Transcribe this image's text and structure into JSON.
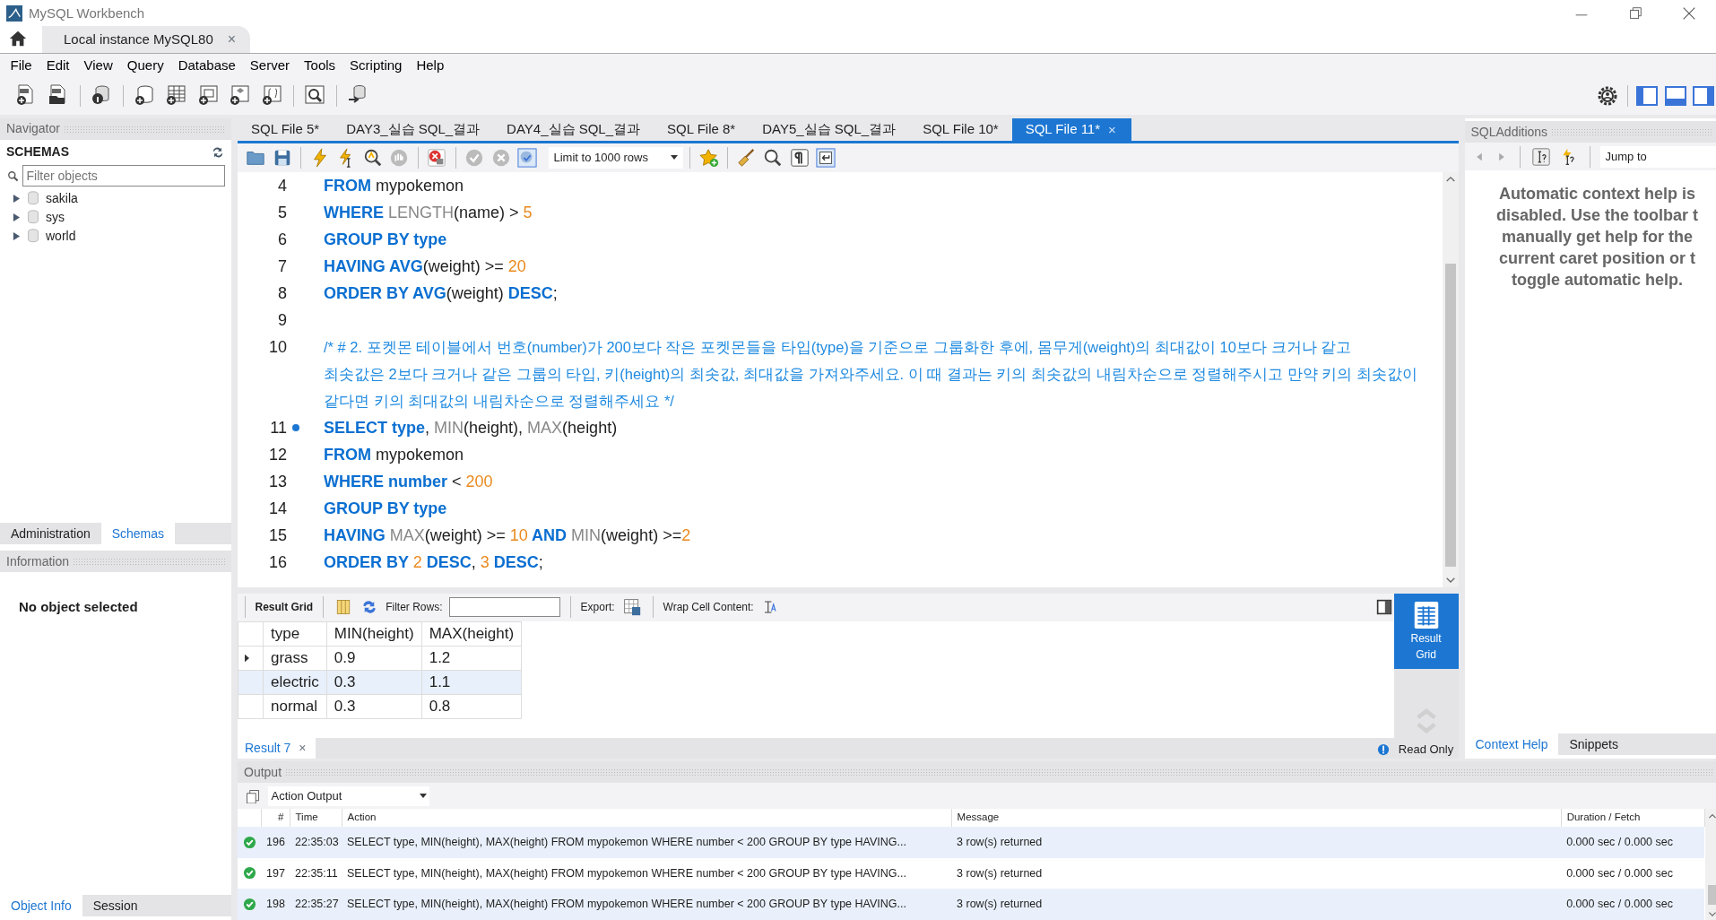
{
  "window": {
    "title": "MySQL Workbench"
  },
  "connection_tab": {
    "label": "Local instance MySQL80",
    "close": "×"
  },
  "menu": [
    "File",
    "Edit",
    "View",
    "Query",
    "Database",
    "Server",
    "Tools",
    "Scripting",
    "Help"
  ],
  "navigator": {
    "title": "Navigator",
    "section": "SCHEMAS",
    "filter": {
      "placeholder": "Filter objects"
    },
    "schemas": [
      {
        "name": "sakila",
        "expanded": false
      },
      {
        "name": "sys",
        "expanded": false
      },
      {
        "name": "world",
        "expanded": false
      }
    ],
    "tabs": [
      {
        "label": "Administration",
        "selected": false
      },
      {
        "label": "Schemas",
        "selected": true
      }
    ]
  },
  "information": {
    "title": "Information",
    "message": "No object selected",
    "tabs": [
      {
        "label": "Object Info",
        "selected": true
      },
      {
        "label": "Session",
        "selected": false
      }
    ]
  },
  "editor_tabs": [
    {
      "label": "SQL File 5*",
      "selected": false
    },
    {
      "label": "DAY3_실습 SQL_결과",
      "selected": false
    },
    {
      "label": "DAY4_실습 SQL_결과",
      "selected": false
    },
    {
      "label": "SQL File 8*",
      "selected": false
    },
    {
      "label": "DAY5_실습 SQL_결과",
      "selected": false
    },
    {
      "label": "SQL File 10*",
      "selected": false
    },
    {
      "label": "SQL File 11*",
      "selected": true,
      "close": "×"
    }
  ],
  "editor_toolbar": {
    "limit": "Limit to 1000 rows"
  },
  "code_lines": [
    {
      "number": "4",
      "marker": false,
      "tokens": [
        {
          "kind": "keyword",
          "text": "FROM"
        },
        {
          "kind": "plain",
          "text": " mypokemon"
        }
      ]
    },
    {
      "number": "5",
      "marker": false,
      "tokens": [
        {
          "kind": "keyword",
          "text": "WHERE "
        },
        {
          "kind": "function",
          "text": "LENGTH"
        },
        {
          "kind": "plain",
          "text": "(name) > "
        },
        {
          "kind": "number",
          "text": "5"
        }
      ]
    },
    {
      "number": "6",
      "marker": false,
      "tokens": [
        {
          "kind": "keyword",
          "text": "GROUP BY type"
        }
      ]
    },
    {
      "number": "7",
      "marker": false,
      "tokens": [
        {
          "kind": "keyword",
          "text": "HAVING AVG"
        },
        {
          "kind": "plain",
          "text": "(weight) >= "
        },
        {
          "kind": "number",
          "text": "20"
        }
      ]
    },
    {
      "number": "8",
      "marker": false,
      "tokens": [
        {
          "kind": "keyword",
          "text": "ORDER BY AVG"
        },
        {
          "kind": "plain",
          "text": "(weight) "
        },
        {
          "kind": "keyword",
          "text": "DESC"
        },
        {
          "kind": "plain",
          "text": ";"
        }
      ]
    },
    {
      "number": "9",
      "marker": false
    },
    {
      "number": "10",
      "marker": false,
      "tokens": [
        {
          "kind": "comment",
          "text": "/* # 2. 포켓몬 테이블에서 번호(number)가 200보다 작은 포켓몬들을 타입(type)을 기준으로 그룹화한 후에, 몸무게(weight)의 최대값이 10보다 크거나 같고"
        }
      ],
      "wrap": [
        "최솟값은 2보다 크거나 같은 그룹의 타입, 키(height)의 최솟값, 최대값을 가져와주세요. 이 때 결과는 키의 최솟값의 내림차순으로 정렬해주시고 만약 키의 최솟값이",
        "같다면 키의 최대값의 내림차순으로 정렬해주세요 */"
      ]
    },
    {
      "number": "11",
      "marker": true,
      "tokens": [
        {
          "kind": "keyword",
          "text": "SELECT type"
        },
        {
          "kind": "plain",
          "text": ", "
        },
        {
          "kind": "function",
          "text": "MIN"
        },
        {
          "kind": "plain",
          "text": "(height), "
        },
        {
          "kind": "function",
          "text": "MAX"
        },
        {
          "kind": "plain",
          "text": "(height)"
        }
      ]
    },
    {
      "number": "12",
      "marker": false,
      "tokens": [
        {
          "kind": "keyword",
          "text": "FROM"
        },
        {
          "kind": "plain",
          "text": " mypokemon"
        }
      ]
    },
    {
      "number": "13",
      "marker": false,
      "tokens": [
        {
          "kind": "keyword",
          "text": "WHERE number"
        },
        {
          "kind": "plain",
          "text": " < "
        },
        {
          "kind": "number",
          "text": "200"
        }
      ]
    },
    {
      "number": "14",
      "marker": false,
      "tokens": [
        {
          "kind": "keyword",
          "text": "GROUP BY type"
        }
      ]
    },
    {
      "number": "15",
      "marker": false,
      "tokens": [
        {
          "kind": "keyword",
          "text": "HAVING "
        },
        {
          "kind": "function",
          "text": "MAX"
        },
        {
          "kind": "plain",
          "text": "(weight) >= "
        },
        {
          "kind": "number",
          "text": "10"
        },
        {
          "kind": "keyword",
          "text": " AND "
        },
        {
          "kind": "function",
          "text": "MIN"
        },
        {
          "kind": "plain",
          "text": "(weight) >="
        },
        {
          "kind": "number",
          "text": "2"
        }
      ]
    },
    {
      "number": "16",
      "marker": false,
      "tokens": [
        {
          "kind": "keyword",
          "text": "ORDER BY "
        },
        {
          "kind": "number",
          "text": "2"
        },
        {
          "kind": "keyword",
          "text": " DESC"
        },
        {
          "kind": "plain",
          "text": ", "
        },
        {
          "kind": "number",
          "text": "3"
        },
        {
          "kind": "keyword",
          "text": " DESC"
        },
        {
          "kind": "plain",
          "text": ";"
        }
      ]
    }
  ],
  "result": {
    "toolbar": {
      "title": "Result Grid",
      "filter_label": "Filter Rows:",
      "export_label": "Export:",
      "wrap_label": "Wrap Cell Content:"
    },
    "columns": [
      "type",
      "MIN(height)",
      "MAX(height)"
    ],
    "rows": [
      {
        "cells": [
          "grass",
          "0.9",
          "1.2"
        ],
        "current": true,
        "selected": false
      },
      {
        "cells": [
          "electric",
          "0.3",
          "1.1"
        ],
        "current": false,
        "selected": true
      },
      {
        "cells": [
          "normal",
          "0.3",
          "0.8"
        ],
        "current": false,
        "selected": false
      }
    ],
    "side_tabs": [
      {
        "label": "Result Grid",
        "selected": true
      }
    ],
    "status": "Read Only",
    "tabs": [
      {
        "label": "Result 7",
        "close": "×",
        "selected": true
      }
    ]
  },
  "sql_additions": {
    "title": "SQLAdditions",
    "jump": "Jump to",
    "help": [
      "Automatic context help is",
      "disabled. Use the toolbar t",
      "manually get help for the",
      "current caret position or t",
      "toggle automatic help."
    ],
    "tabs": [
      {
        "label": "Context Help",
        "selected": true
      },
      {
        "label": "Snippets",
        "selected": false
      }
    ]
  },
  "output": {
    "title": "Output",
    "mode": "Action Output",
    "columns": [
      "#",
      "Time",
      "Action",
      "Message",
      "Duration / Fetch"
    ],
    "rows": [
      {
        "succeeded": true,
        "number": "196",
        "time": "22:35:03",
        "action": "SELECT type, MIN(height), MAX(height) FROM mypokemon WHERE number < 200 GROUP BY type HAVING...",
        "message": "3 row(s) returned",
        "duration": "0.000 sec / 0.000 sec"
      },
      {
        "succeeded": true,
        "number": "197",
        "time": "22:35:11",
        "action": "SELECT type, MIN(height), MAX(height) FROM mypokemon WHERE number < 200 GROUP BY type HAVING...",
        "message": "3 row(s) returned",
        "duration": "0.000 sec / 0.000 sec"
      },
      {
        "succeeded": true,
        "number": "198",
        "time": "22:35:27",
        "action": "SELECT type, MIN(height), MAX(height) FROM mypokemon WHERE number < 200 GROUP BY type HAVING...",
        "message": "3 row(s) returned",
        "duration": "0.000 sec / 0.000 sec"
      }
    ]
  }
}
